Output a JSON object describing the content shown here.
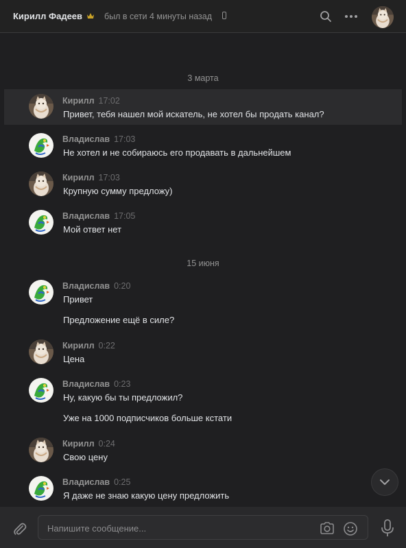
{
  "header": {
    "name": "Кирилл Фадеев",
    "status": "был в сети 4 минуты назад",
    "icons": [
      "crown-icon",
      "mobile-icon",
      "search-icon",
      "more-icon",
      "avatar"
    ]
  },
  "colors": {
    "background": "#1f1f21",
    "highlight": "#2c2c2e",
    "text": "#e1e3e6",
    "muted": "#939393"
  },
  "dates": [
    "3 марта",
    "15 июня"
  ],
  "messages": [
    {
      "author": "Кирилл",
      "time": "17:02",
      "text": "Привет, тебя нашел мой искатель, не хотел бы продать канал?"
    },
    {
      "author": "Владислав",
      "time": "17:03",
      "text": "Не хотел и не собираюсь его продавать в дальнейшем"
    },
    {
      "author": "Кирилл",
      "time": "17:03",
      "text": "Крупную сумму предложу)"
    },
    {
      "author": "Владислав",
      "time": "17:05",
      "text": "Мой ответ нет"
    },
    {
      "author": "Владислав",
      "time": "0:20",
      "text": "Привет",
      "text2": "Предложение ещё в силе?"
    },
    {
      "author": "Кирилл",
      "time": "0:22",
      "text": "Цена"
    },
    {
      "author": "Владислав",
      "time": "0:23",
      "text": "Ну, какую бы ты предложил?",
      "text2": "Уже на 1000 подписчиков больше кстати"
    },
    {
      "author": "Кирилл",
      "time": "0:24",
      "text": "Свою цену"
    },
    {
      "author": "Владислав",
      "time": "0:25",
      "text": "Я даже не знаю какую цену предложить"
    }
  ],
  "composer": {
    "placeholder": "Напишите сообщение...",
    "icons": [
      "paperclip-icon",
      "camera-icon",
      "smile-icon",
      "microphone-icon"
    ]
  }
}
